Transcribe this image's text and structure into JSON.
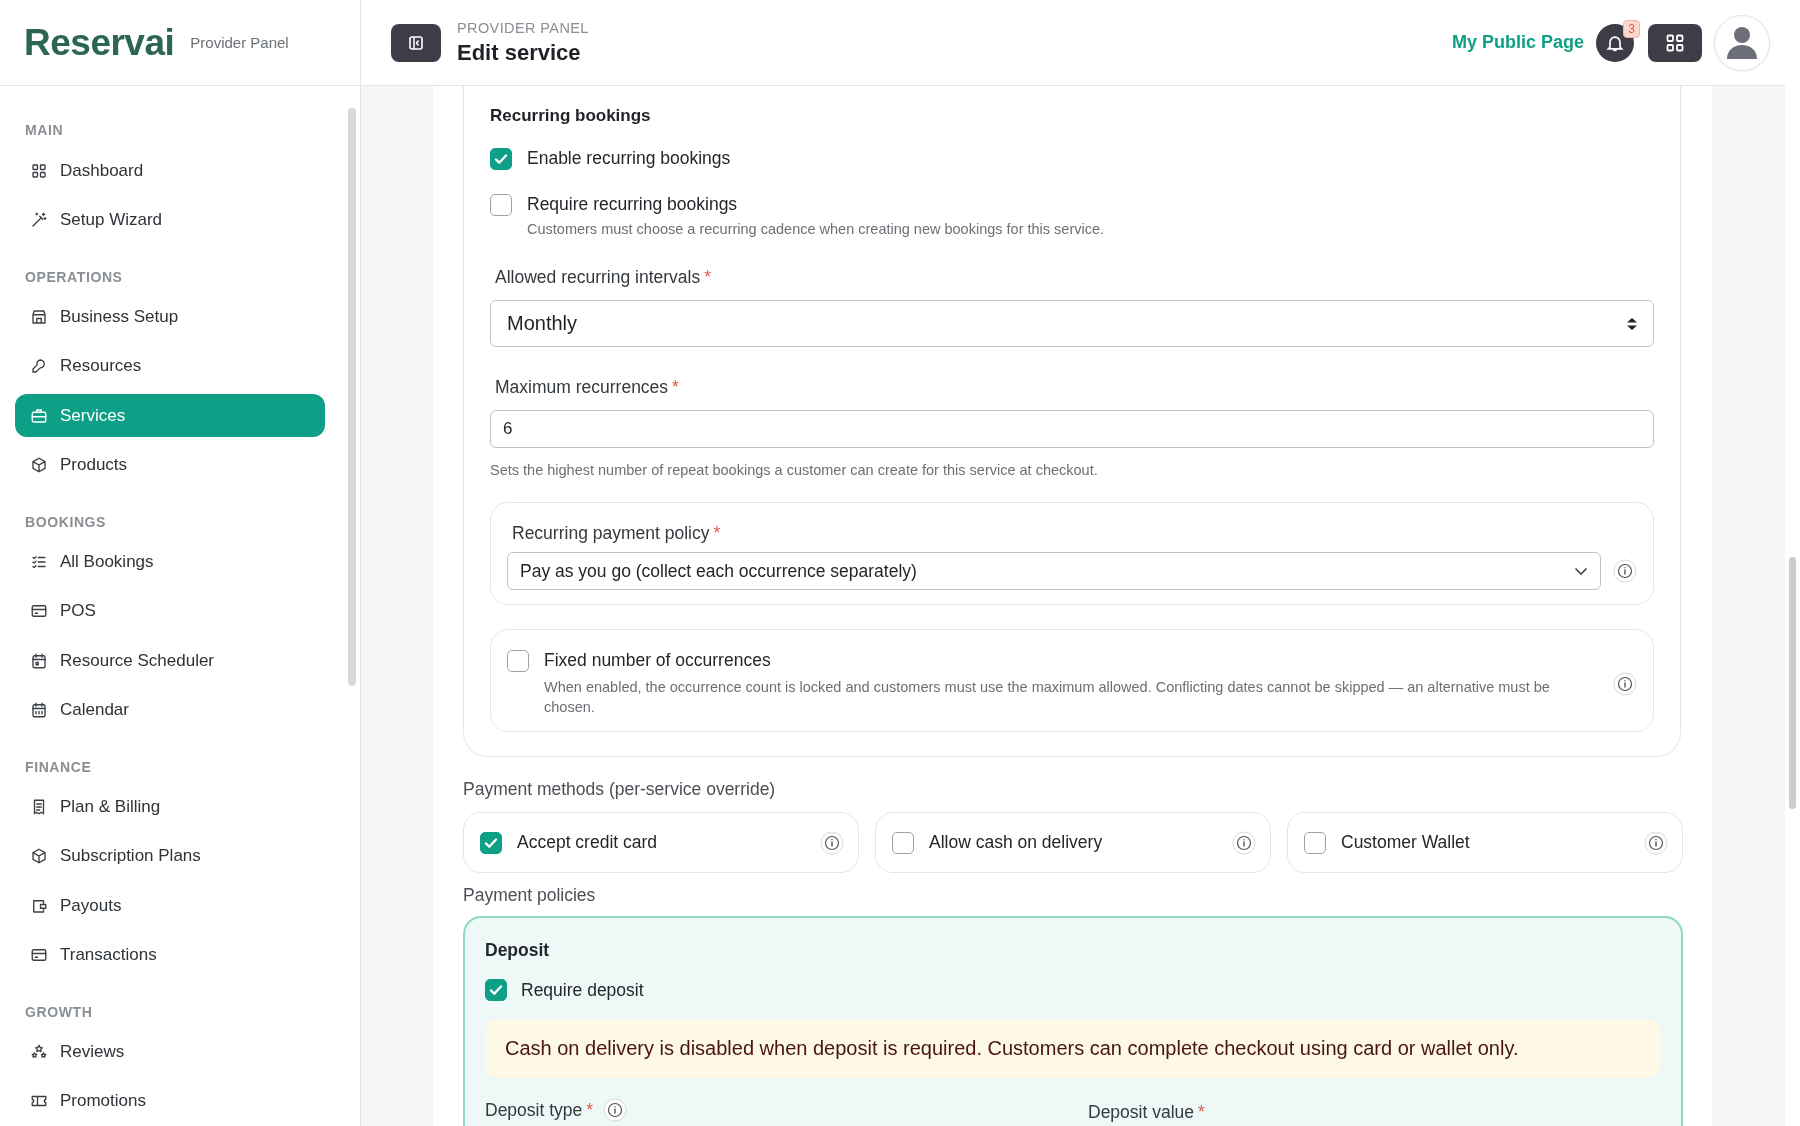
{
  "brand": {
    "name": "Reservai",
    "subtitle": "Provider Panel"
  },
  "sidebar": {
    "sections": [
      {
        "title": "MAIN",
        "items": [
          {
            "label": "Dashboard",
            "selected": false
          },
          {
            "label": "Setup Wizard",
            "selected": false
          }
        ]
      },
      {
        "title": "OPERATIONS",
        "items": [
          {
            "label": "Business Setup",
            "selected": false
          },
          {
            "label": "Resources",
            "selected": false
          },
          {
            "label": "Services",
            "selected": true
          },
          {
            "label": "Products",
            "selected": false
          }
        ]
      },
      {
        "title": "BOOKINGS",
        "items": [
          {
            "label": "All Bookings",
            "selected": false
          },
          {
            "label": "POS",
            "selected": false
          },
          {
            "label": "Resource Scheduler",
            "selected": false
          },
          {
            "label": "Calendar",
            "selected": false
          }
        ]
      },
      {
        "title": "FINANCE",
        "items": [
          {
            "label": "Plan & Billing",
            "selected": false
          },
          {
            "label": "Subscription Plans",
            "selected": false
          },
          {
            "label": "Payouts",
            "selected": false
          },
          {
            "label": "Transactions",
            "selected": false
          }
        ]
      },
      {
        "title": "GROWTH",
        "items": [
          {
            "label": "Reviews",
            "selected": false
          },
          {
            "label": "Promotions",
            "selected": false
          }
        ]
      }
    ]
  },
  "header": {
    "eyebrow": "PROVIDER PANEL",
    "title": "Edit service",
    "public_link": "My Public Page",
    "notification_count": "3"
  },
  "recurring": {
    "title": "Recurring bookings",
    "options": [
      {
        "label": "Enable recurring bookings",
        "checked": true
      },
      {
        "label": "Require recurring bookings",
        "checked": false,
        "hint": "Customers must choose a recurring cadence when creating new bookings for this service."
      }
    ],
    "intervals": {
      "label": "Allowed recurring intervals",
      "required_mark": "*",
      "value": "Monthly"
    },
    "max_recurrences": {
      "label": "Maximum recurrences",
      "required_mark": "*",
      "value": "6",
      "hint": "Sets the highest number of repeat bookings a customer can create for this service at checkout."
    },
    "payment_policy": {
      "label": "Recurring payment policy",
      "required_mark": "*",
      "value": "Pay as you go (collect each occurrence separately)"
    },
    "fixed": {
      "label": "Fixed number of occurrences",
      "checked": false,
      "hint": "When enabled, the occurrence count is locked and customers must use the maximum allowed. Conflicting dates cannot be skipped — an alternative must be chosen."
    }
  },
  "payment_methods": {
    "title": "Payment methods (per-service override)",
    "items": [
      {
        "label": "Accept credit card",
        "checked": true
      },
      {
        "label": "Allow cash on delivery",
        "checked": false
      },
      {
        "label": "Customer Wallet",
        "checked": false
      }
    ]
  },
  "payment_policies": {
    "title": "Payment policies",
    "deposit": {
      "title": "Deposit",
      "require": {
        "label": "Require deposit",
        "checked": true
      },
      "notice": "Cash on delivery is disabled when deposit is required. Customers can complete checkout using card or wallet only.",
      "fields": [
        {
          "label": "Deposit type",
          "required_mark": "*"
        },
        {
          "label": "Deposit value",
          "required_mark": "*"
        }
      ]
    }
  }
}
